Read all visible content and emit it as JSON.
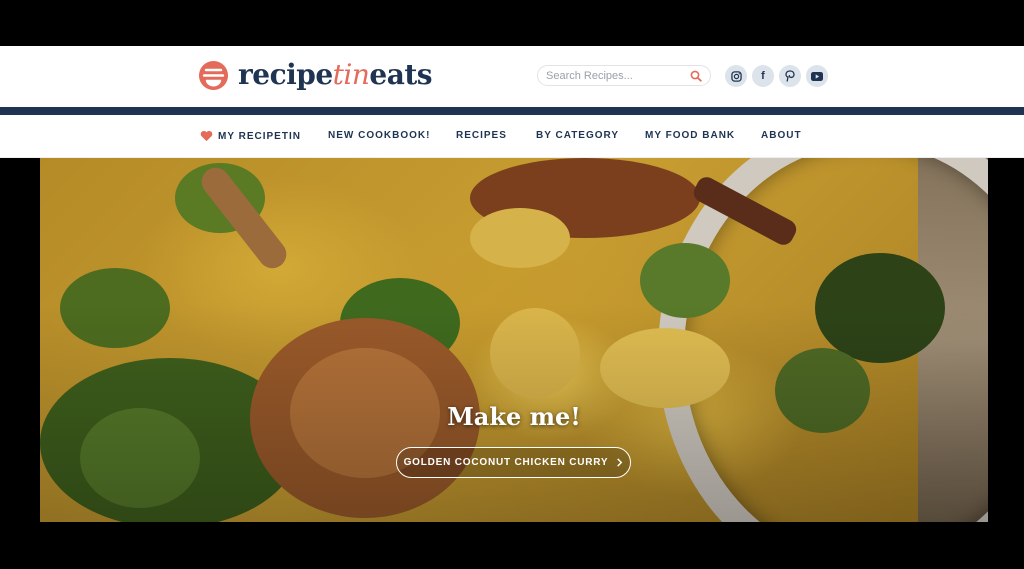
{
  "header": {
    "logo_part1": "recipe",
    "logo_part2": "tin",
    "logo_part3": "eats",
    "search_placeholder": "Search Recipes...",
    "socials": [
      {
        "icon": "instagram-icon",
        "glyph": "◎"
      },
      {
        "icon": "facebook-icon",
        "glyph": "f"
      },
      {
        "icon": "pinterest-icon",
        "glyph": "P"
      },
      {
        "icon": "youtube-icon",
        "glyph": "▶"
      }
    ]
  },
  "nav": {
    "items": [
      "MY RECIPETIN",
      "NEW COOKBOOK!",
      "RECIPES",
      "BY CATEGORY",
      "MY FOOD BANK",
      "ABOUT"
    ]
  },
  "hero": {
    "title": "Make me!",
    "button_label": "GOLDEN COCONUT CHICKEN CURRY"
  },
  "colors": {
    "navy": "#1f3452",
    "coral": "#e46a5a",
    "social_bg": "#dde3ea"
  }
}
